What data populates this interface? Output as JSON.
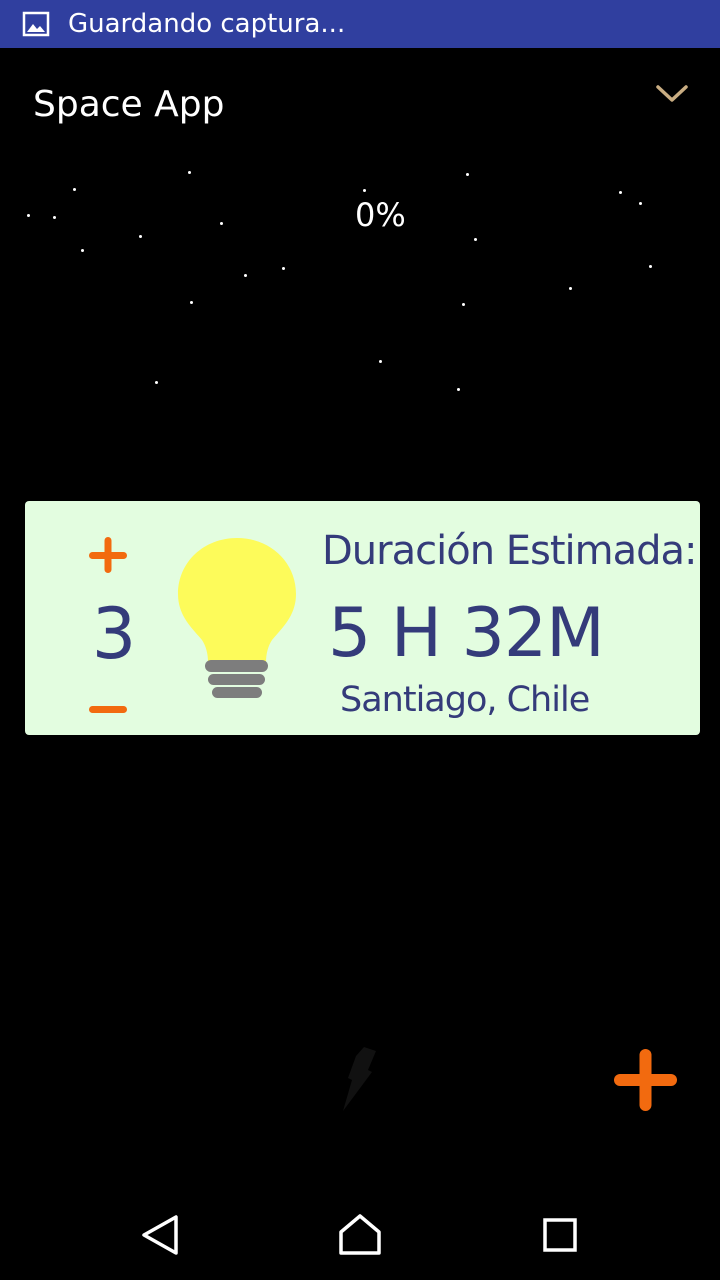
{
  "status_bar": {
    "notification_icon": "image-icon",
    "text": "Guardando captura..."
  },
  "app_bar": {
    "title": "Space App",
    "menu_icon": "chevron-down-icon"
  },
  "progress": {
    "percent_label": "0%",
    "value": 0
  },
  "card": {
    "increment_icon": "plus-icon",
    "decrement_icon": "minus-icon",
    "count": "3",
    "bulb_icon": "lightbulb-icon",
    "duration_label": "Duración Estimada:",
    "duration_value": "5 H 32M",
    "location": "Santiago, Chile"
  },
  "bottom": {
    "lightning_icon": "lightning-icon",
    "add_icon": "plus-icon"
  },
  "nav": {
    "back_icon": "back-icon",
    "home_icon": "home-icon",
    "recents_icon": "recents-icon"
  },
  "colors": {
    "status_bar": "#303f9f",
    "accent_orange": "#f26a0f",
    "card_bg": "#e3fde0",
    "text_navy": "#343b7a",
    "bulb_yellow": "#fdfb5a",
    "chevron": "#c9ad82"
  }
}
